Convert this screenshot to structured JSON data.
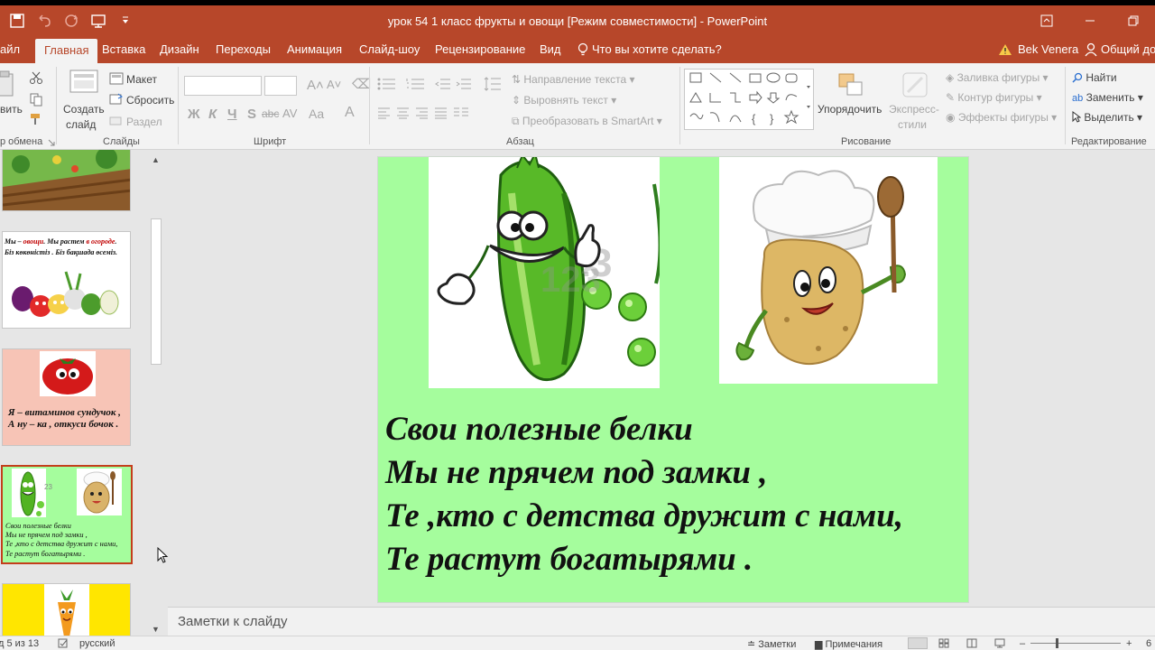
{
  "window": {
    "title": "урок 54 1 класс фрукты и овощи [Режим совместимости] - PowerPoint"
  },
  "tabs": [
    {
      "label": "айл"
    },
    {
      "label": "Главная"
    },
    {
      "label": "Вставка"
    },
    {
      "label": "Дизайн"
    },
    {
      "label": "Переходы"
    },
    {
      "label": "Анимация"
    },
    {
      "label": "Слайд-шоу"
    },
    {
      "label": "Рецензирование"
    },
    {
      "label": "Вид"
    }
  ],
  "tellme": "Что вы хотите сделать?",
  "user": {
    "name": "Bek Venera",
    "share": "Общий до"
  },
  "ribbon": {
    "clipboard": {
      "paste": "вить",
      "group": "р обмена"
    },
    "slides": {
      "new_slide_1": "Создать",
      "new_slide_2": "слайд",
      "layout": "Макет",
      "reset": "Сбросить",
      "section": "Раздел",
      "group": "Слайды"
    },
    "font": {
      "bold": "Ж",
      "italic": "К",
      "underline": "Ч",
      "strike": "S",
      "shadow": "abc",
      "spacing": "AV",
      "case": "Aa",
      "color": "A",
      "group": "Шрифт"
    },
    "paragraph": {
      "direction": "Направление текста",
      "align": "Выровнять текст",
      "smartart": "Преобразовать в SmartArt",
      "group": "Абзац"
    },
    "drawing": {
      "arrange_1": "Упорядочить",
      "quick_1": "Экспресс-",
      "quick_2": "стили",
      "fill": "Заливка фигуры",
      "outline": "Контур фигуры",
      "effects": "Эффекты фигуры",
      "group": "Рисование"
    },
    "editing": {
      "find": "Найти",
      "replace": "Заменить",
      "select": "Выделить",
      "group": "Редактирование"
    }
  },
  "thumbnails": [
    {
      "text": ""
    },
    {
      "line1_a": "Мы – ",
      "line1_b": "овощи",
      "line1_c": ". Мы растем ",
      "line1_d": "в огороде",
      "line1_e": ".",
      "line2": "Біз көкөністіз . Біз бақшада өсеміз."
    },
    {
      "line1": "Я – витаминов сундучок ,",
      "line2": "А ну – ка , откуси бочок ."
    },
    {
      "line1": "Свои полезные белки",
      "line2": "Мы не прячем под замки ,",
      "line3": "Те ,кто с детства дружит с нами,",
      "line4": "Те растут богатырями ."
    },
    {
      "text": ""
    }
  ],
  "slide": {
    "watermark": "123",
    "lines": [
      "Свои полезные белки",
      "Мы не прячем под замки ,",
      "Те ,кто с детства дружит с нами,",
      "Те растут богатырями ."
    ]
  },
  "notes": {
    "placeholder": "Заметки к слайду"
  },
  "status": {
    "slide_of": "д 5 из 13",
    "language": "русский",
    "notes": "Заметки",
    "comments": "Примечания",
    "zoom": "6"
  },
  "colors": {
    "accent": "#b7472a",
    "slide_bg": "#a5fd9d",
    "selection": "#c43e1c"
  }
}
